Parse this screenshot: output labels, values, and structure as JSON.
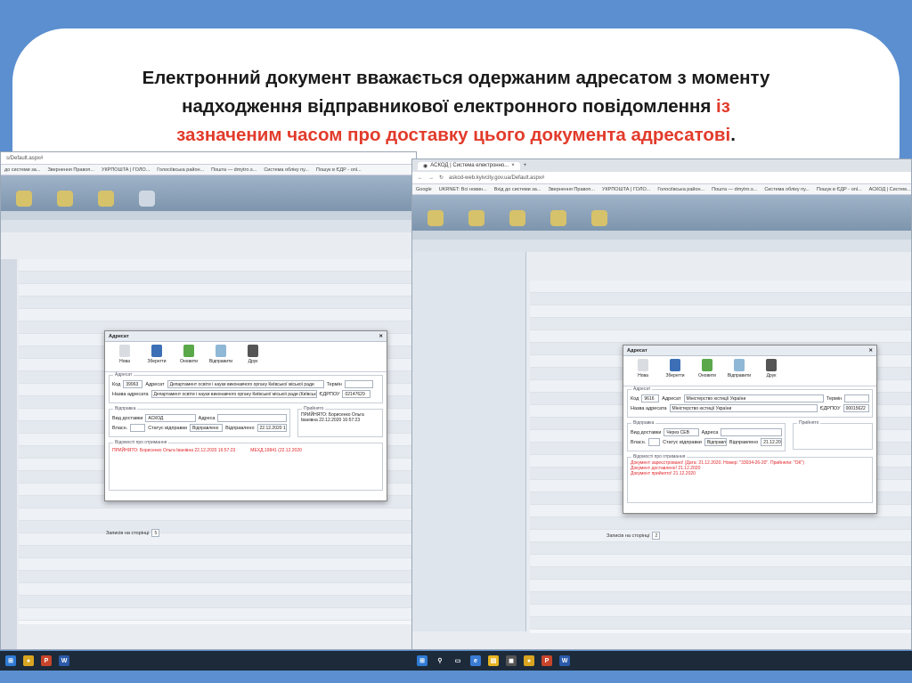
{
  "heading": {
    "line1": "Електронний документ вважається одержаним адресатом з моменту",
    "line2_black": "надходження відправникової електронного повідомлення ",
    "line2_red": "із",
    "line3_red": "зазначеним часом про доставку цього документа адресатові",
    "line3_dot": "."
  },
  "left_window": {
    "address": "s/Default.aspx#",
    "bookmarks": [
      "до системи за...",
      "Звернення Правоп...",
      "УКРПОШТА | ГОЛО...",
      "Голосіївська район...",
      "Пошта — dmytro.s...",
      "Система обліку пу...",
      "Пошук в ЄДР - onl..."
    ],
    "dialog": {
      "title": "Адресат",
      "tools": [
        "Нова",
        "Зберегти",
        "Оновити",
        "Відправити",
        "Друк"
      ],
      "section_addressee": "Адресат",
      "code_label": "Код",
      "code_value": "39963",
      "addressee_label": "Адресат",
      "addressee_value": "Департамент освіти і науки виконавчого органу Київської міської ради",
      "term_label": "Термін",
      "fullname_label": "Назва адресата",
      "fullname_value": "Департамент освіти і науки виконавчого органу Київської міської ради (Київська",
      "edrpou_label": "ЄДРПОУ",
      "edrpou_value": "02147629",
      "section_dispatch": "Відправка",
      "delivery_label": "Вид доставки",
      "delivery_value": "АСКОД",
      "address_label": "Адреса",
      "accepted_label": "Прийнято",
      "accepted_value": "ПРИЙНЯТО: Борисенко Ольга Іванівна 22.12.2020 16:57:23",
      "own_label": "Власн.",
      "status_label": "Статус відправки",
      "status_value": "Відправлено",
      "sent_label": "Відправлено",
      "sent_value": "22.12.2020 16",
      "section_info": "Відомості про отримання",
      "info_red_a": "ПРИЙНЯТО: Борисенко Ольга Іванівна 22.12.2020 16:57:23",
      "info_red_b": "МЕХД.19841 (22.12.2020"
    },
    "page_size_label": "Записів на сторінці",
    "page_size_value": "5"
  },
  "right_window": {
    "tab_title": "АСКОД | Система електронно...",
    "address": "askod-web.kyivcity.gov.ua/Default.aspx#",
    "bookmarks": [
      "Google",
      "UKRNET: Всі новин...",
      "Вхід до системи за...",
      "Звернення Правоп...",
      "УКРПОШТА | ГОЛО...",
      "Голосіївська район...",
      "Пошта — dmytro.s...",
      "Система обліку пу...",
      "Пошук в ЄДР - onl...",
      "АСКОД | Систем..."
    ],
    "dialog": {
      "title": "Адресат",
      "tools": [
        "Нова",
        "Зберегти",
        "Оновити",
        "Відправити",
        "Друк"
      ],
      "section_addressee": "Адресат",
      "code_label": "Код",
      "code_value": "9616",
      "addressee_label": "Адресат",
      "addressee_value": "Міністерство юстиції України",
      "term_label": "Термін",
      "fullname_label": "Назва адресата",
      "fullname_value": "Міністерство юстиції України",
      "edrpou_label": "ЄДРПОУ",
      "edrpou_value": "00015622",
      "section_dispatch": "Відправка",
      "delivery_label": "Вид доставки",
      "delivery_value": "Через СЕВ",
      "address_label": "Адреса",
      "accepted_label": "Прийнято",
      "own_label": "Власн.",
      "status_label": "Статус відправки",
      "status_value": "Відправлено",
      "sent_label": "Відправлено",
      "sent_value": "21.12.2020 01",
      "section_info": "Відомості про отримання",
      "info_red": [
        "Документ зареєстровано! (Дата: 21.12.2020. Номер: \"33034-26-20\". Прийняли: \"ОК\")",
        "Документ доставлено! 21.12.2020",
        "Документ прийнято! 21.12.2020"
      ]
    },
    "page_size_label": "Записів на сторінці",
    "page_size_value": "2"
  }
}
